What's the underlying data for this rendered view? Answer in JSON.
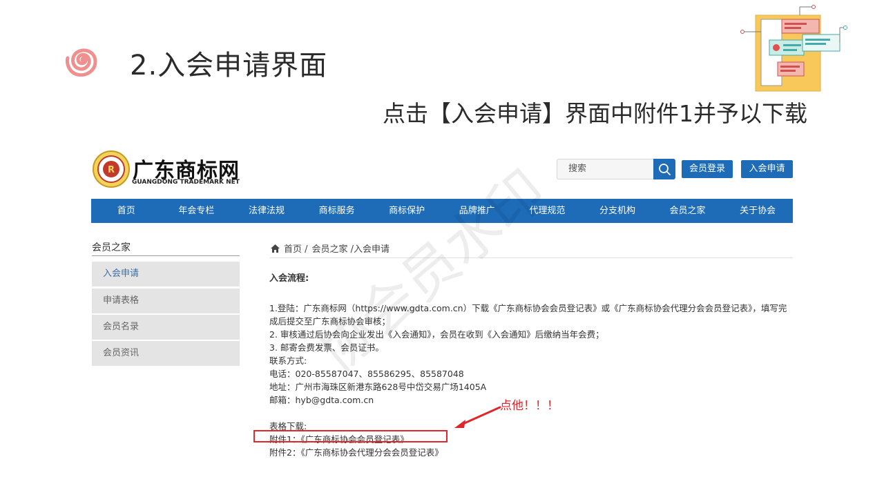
{
  "slide": {
    "title": "2.入会申请界面",
    "subtitle": "点击【入会申请】界面中附件1并予以下载"
  },
  "site": {
    "name_cn": "广东商标网",
    "name_en": "GUANGDONG TRADEMARK NET",
    "search_placeholder": "搜索",
    "login_label": "会员登录",
    "join_label": "入会申请",
    "nav": [
      "首页",
      "年会专栏",
      "法律法规",
      "商标服务",
      "商标保护",
      "品牌推广",
      "代理规范",
      "分支机构",
      "会员之家",
      "关于协会"
    ]
  },
  "sidebar": {
    "title": "会员之家",
    "items": [
      {
        "label": "入会申请",
        "active": true
      },
      {
        "label": "申请表格",
        "active": false
      },
      {
        "label": "会员名录",
        "active": false
      },
      {
        "label": "会员资讯",
        "active": false
      }
    ]
  },
  "breadcrumb": {
    "home": "首页 /",
    "section": "会员之家 /入会申请"
  },
  "content": {
    "process_title": "入会流程:",
    "step1": "1.登陆：广东商标网（https://www.gdta.com.cn）下载《广东商标协会会员登记表》或《广东商标协会代理分会会员登记表》，填写完成后提交至广东商标协会审核；",
    "step2": "2. 审核通过后协会向企业发出《入会通知》，会员在收到《入会通知》后缴纳当年会费；",
    "step3": "3. 邮寄会费发票、会员证书。",
    "contact_title": "联系方式:",
    "phone": "电话：020-85587047、85586295、85587048",
    "address": "地址：广州市海珠区新港东路628号中岱交易广场1405A",
    "email": "邮箱：hyb@gdta.com.cn",
    "download_title": "表格下载:",
    "attachment1": "附件1：《广东商标协会会员登记表》",
    "attachment2": "附件2：《广东商标协会代理分会会员登记表》"
  },
  "annotation": {
    "note": "点他！！！",
    "color": "#e0252b"
  },
  "watermark": "协会员水印",
  "colors": {
    "brand_blue": "#1e6bb8",
    "swirl_pink": "#ef8f8f"
  }
}
